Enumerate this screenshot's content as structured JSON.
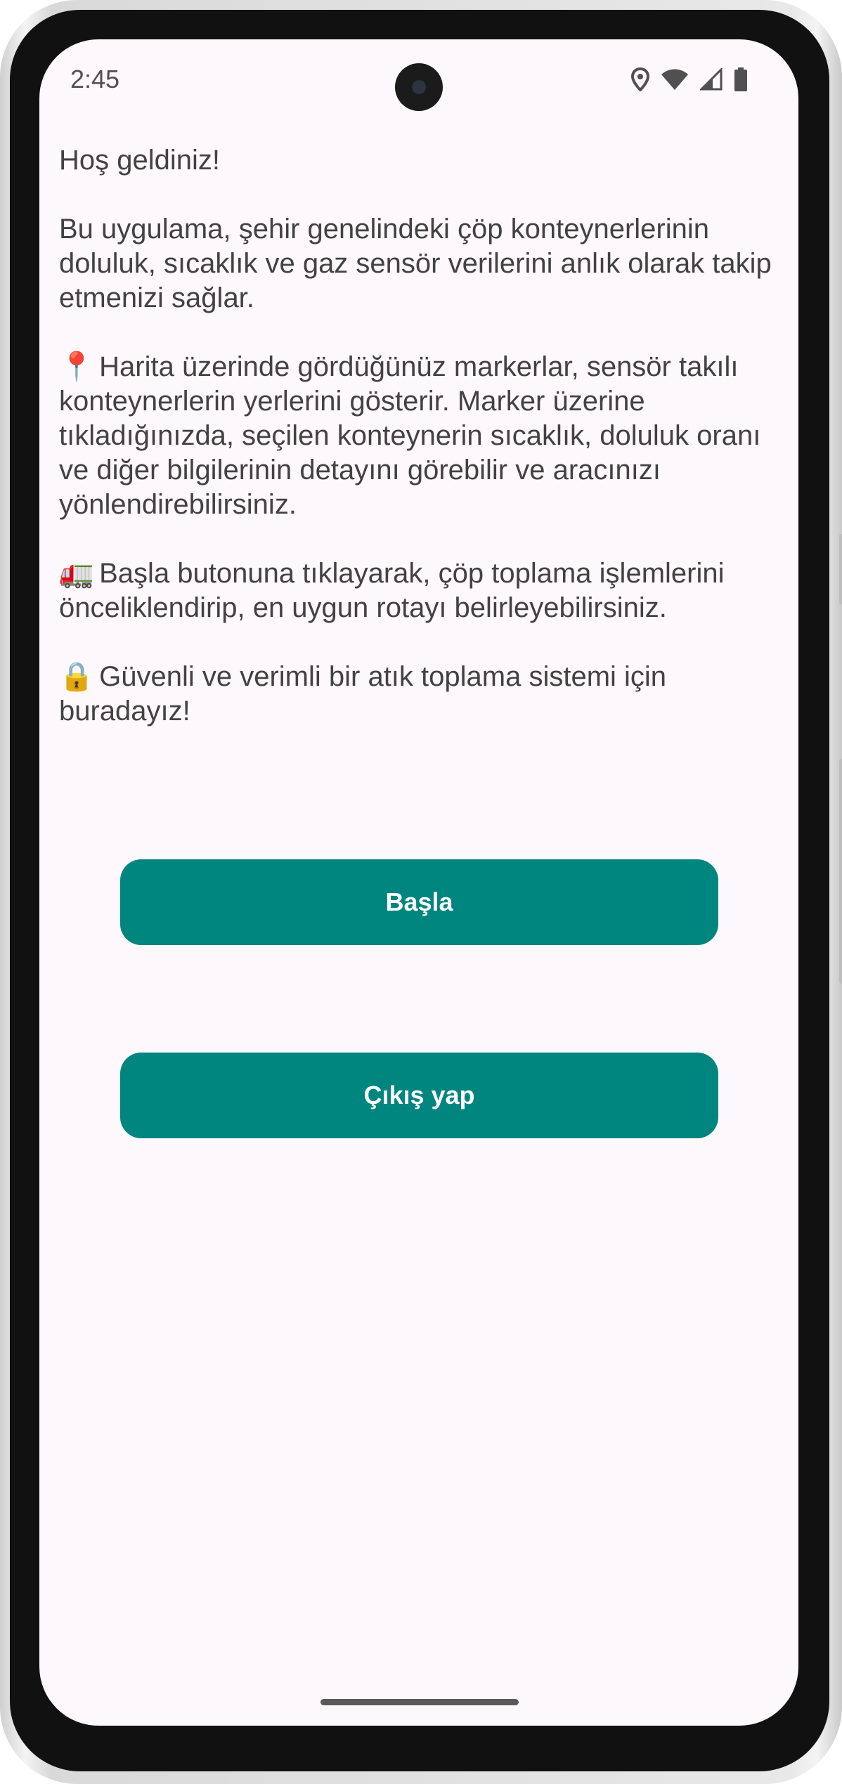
{
  "status_bar": {
    "time": "2:45",
    "icons": [
      "location-icon",
      "wifi-icon",
      "signal-icon",
      "battery-icon"
    ]
  },
  "welcome": {
    "greeting": "Hoş geldiniz!",
    "intro": "Bu uygulama, şehir genelindeki çöp konteynerlerinin doluluk, sıcaklık ve gaz sensör verilerini anlık olarak takip etmenizi sağlar.",
    "map_emoji": "📍",
    "map_text": "Harita üzerinde gördüğünüz markerlar, sensör takılı konteynerlerin yerlerini gösterir. Marker üzerine tıkladığınızda, seçilen konteynerin sıcaklık, doluluk oranı ve diğer bilgilerinin detayını görebilir ve aracınızı yönlendirebilirsiniz.",
    "truck_emoji": "🚛",
    "truck_text": "Başla butonuna tıklayarak, çöp toplama işlemlerini önceliklendirip, en uygun rotayı belirleyebilirsiniz.",
    "lock_emoji": "🔒",
    "lock_text": "Güvenli ve verimli bir atık toplama sistemi için buradayız!"
  },
  "buttons": {
    "start_label": "Başla",
    "logout_label": "Çıkış yap"
  },
  "colors": {
    "accent": "#00857f",
    "background": "#fdf8fb",
    "text": "#424242"
  }
}
